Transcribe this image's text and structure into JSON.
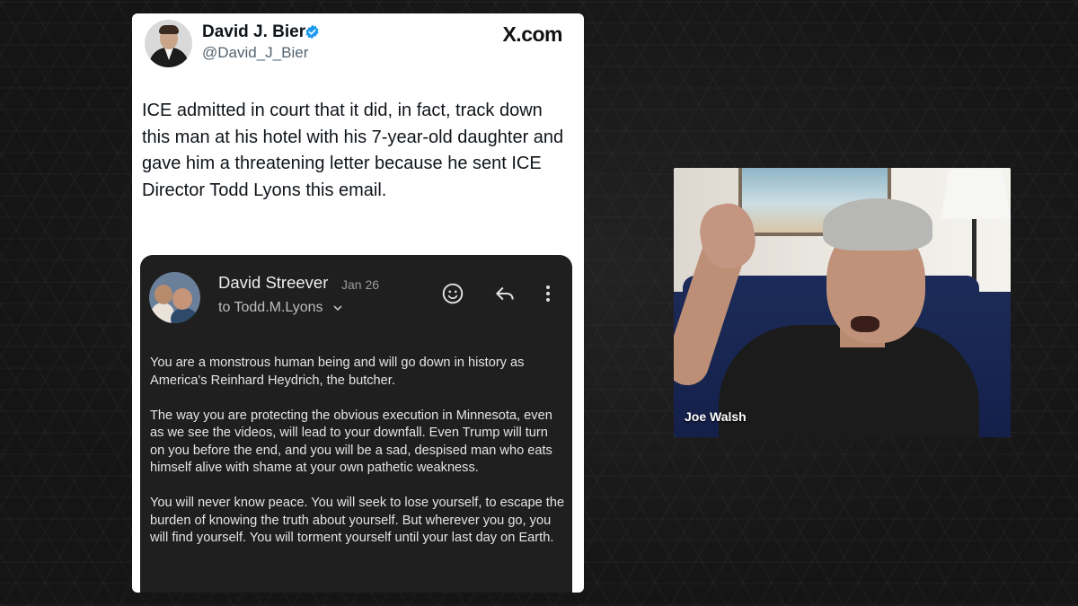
{
  "tweet": {
    "author_name": "David J. Bier",
    "author_handle": "@David_J_Bier",
    "verified": true,
    "site_label": "X.com",
    "text": "ICE admitted in court that it did, in fact, track down this man at his hotel with his 7-year-old daughter and gave him a threatening letter because he sent ICE Director Todd Lyons this email."
  },
  "email": {
    "sender": "David Streever",
    "date": "Jan 26",
    "to_line": "to Todd.M.Lyons",
    "icons": [
      "emoji-icon",
      "reply-icon",
      "more-vert-icon"
    ],
    "paragraphs": [
      "You are a monstrous human being and will go down in history as America's Reinhard Heydrich, the butcher.",
      "The way you are protecting the obvious execution in Minnesota, even as we see the videos, will lead to your downfall. Even Trump will turn on you before the end, and you will be a sad, despised man who eats himself alive with shame at your own pathetic weakness.",
      "You will never know peace. You will seek to lose yourself, to escape the burden of knowing the truth about yourself. But wherever you go, you will find yourself. You will torment yourself until your last day on Earth."
    ]
  },
  "video": {
    "participant_name": "Joe Walsh"
  },
  "colors": {
    "verified_blue": "#1d9bf0",
    "background": "#151515",
    "email_background": "#1f1f1f"
  }
}
